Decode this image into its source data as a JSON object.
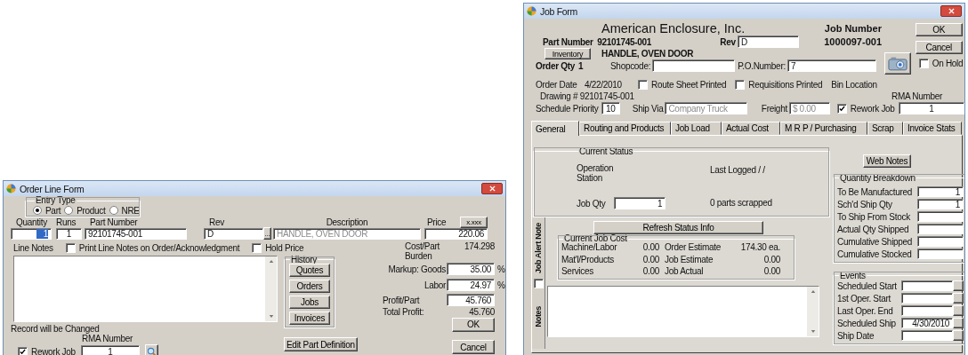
{
  "order_line_form": {
    "title": "Order Line Form",
    "entry_type": {
      "label": "Entry Type",
      "options": [
        {
          "label": "Part",
          "selected": true
        },
        {
          "label": "Product",
          "selected": false
        },
        {
          "label": "NRE",
          "selected": false
        }
      ]
    },
    "line_fields": [
      {
        "label": "Quantity",
        "value": "1",
        "selected": true
      },
      {
        "label": "Runs",
        "value": "1",
        "selected": false
      },
      {
        "label": "Part Number",
        "value": "92101745-001",
        "selected": false
      },
      {
        "label": "Rev",
        "value": "D",
        "selected": false
      },
      {
        "label": "Description",
        "value": "HANDLE, OVEN DOOR",
        "selected": false,
        "disabled": true
      },
      {
        "label": "Price",
        "value": "220.06",
        "selected": false
      }
    ],
    "lookup_button": "...",
    "price_format_button": "x.xxx",
    "line_notes_label": "Line Notes",
    "checkboxes": [
      {
        "label": "Print Line Notes on Order/Acknowledgment",
        "checked": false
      },
      {
        "label": "Hold Price",
        "checked": false
      }
    ],
    "history": {
      "label": "History",
      "buttons": [
        "Quotes",
        "Orders",
        "Jobs",
        "Invoices"
      ]
    },
    "edit_part_button": "Edit Part Definition",
    "cost_per_part": {
      "label": "Cost/Part",
      "value": "174.298"
    },
    "burden_label": "Burden",
    "markup_goods": {
      "label": "Markup: Goods",
      "value": "35.00",
      "unit": "%"
    },
    "labor": {
      "label": "Labor",
      "value": "24.97",
      "unit": "%"
    },
    "profit_per_part": {
      "label": "Profit/Part",
      "value": "45.760"
    },
    "total_profit": {
      "label": "Total Profit:",
      "value": "45.760"
    },
    "ok_button": "OK",
    "cancel_button": "Cancel",
    "status": "Record will be Changed",
    "rma": {
      "label": "RMA Number",
      "value": "1"
    },
    "rework_job": {
      "label": "Rework Job",
      "checked": true
    }
  },
  "job_form": {
    "title": "Job Form",
    "company": "American Enclosure, Inc.",
    "job_number": {
      "label": "Job Number",
      "value": "1000097-001"
    },
    "ok_button": "OK",
    "cancel_button": "Cancel",
    "on_hold": {
      "label": "On Hold",
      "checked": false
    },
    "part_number": {
      "label": "Part Number",
      "value": "92101745-001"
    },
    "rev": {
      "label": "Rev",
      "value": "D"
    },
    "inventory_button": "Inventory",
    "part_description": "HANDLE, OVEN DOOR",
    "order_qty": {
      "label": "Order Qty",
      "value": "1"
    },
    "shopcode": {
      "label": "Shopcode:"
    },
    "po_number": {
      "label": "P.O.Number:",
      "value": "7"
    },
    "order_date": {
      "label": "Order Date",
      "value": "4/22/2010"
    },
    "route_sheet_printed": {
      "label": "Route Sheet Printed",
      "checked": false
    },
    "requisitions_printed": {
      "label": "Requisitions Printed",
      "checked": false
    },
    "bin_location_label": "Bin Location",
    "drawing": "Drawing # 92101745-001",
    "rma": {
      "label": "RMA Number",
      "value": "1"
    },
    "schedule_priority": {
      "label": "Schedule Priority",
      "value": "10"
    },
    "ship_via": {
      "label": "Ship Via",
      "value": "Company Truck",
      "disabled": true
    },
    "freight": {
      "label": "Freight",
      "value": "$  0.00",
      "disabled": true
    },
    "rework_job": {
      "label": "Rework Job",
      "checked": true
    },
    "tabs": [
      {
        "label": "General",
        "selected": true
      },
      {
        "label": "Routing and Products",
        "selected": false
      },
      {
        "label": "Job Load",
        "selected": false
      },
      {
        "label": "Actual Cost",
        "selected": false
      },
      {
        "label": "M R P / Purchasing",
        "selected": false
      },
      {
        "label": "Scrap",
        "selected": false
      },
      {
        "label": "Invoice Stats",
        "selected": false
      }
    ],
    "current_status": {
      "label": "Current Status",
      "operation_label": "Operation",
      "station_label": "Station",
      "last_logged": "Last Logged  / /",
      "job_qty": {
        "label": "Job Qty",
        "value": "1"
      },
      "scrapped": "0 parts scrapped"
    },
    "refresh_button": "Refresh Status Info",
    "job_alert_note": {
      "label": "Job Alert Note",
      "checked": false
    },
    "notes_label": "Notes",
    "current_job_cost": {
      "label": "Current Job Cost",
      "rows": [
        {
          "label": "Machine/Labor",
          "value": "0.00",
          "estimate_label": "Order Estimate",
          "estimate_value": "174.30 ea."
        },
        {
          "label": "Mat'l/Products",
          "value": "0.00",
          "estimate_label": "Job Estimate",
          "estimate_value": "0.00"
        },
        {
          "label": "Services",
          "value": "0.00",
          "estimate_label": "Job Actual",
          "estimate_value": "0.00"
        }
      ]
    },
    "web_notes_button": "Web Notes",
    "quantity_breakdown": {
      "label": "Quantity Breakdown",
      "rows": [
        {
          "label": "To Be Manufactured",
          "value": "1"
        },
        {
          "label": "Sch'd Ship Qty",
          "value": "1"
        },
        {
          "label": "To Ship From Stock"
        },
        {
          "label": "Actual Qty Shipped"
        },
        {
          "label": "Cumulative Shipped"
        },
        {
          "label": "Cumulative Stocked"
        }
      ]
    },
    "events": {
      "label": "Events",
      "rows": [
        {
          "label": "Scheduled Start"
        },
        {
          "label": "1st Oper. Start"
        },
        {
          "label": "Last Oper. End"
        },
        {
          "label": "Scheduled Ship",
          "value": "4/30/2010"
        },
        {
          "label": "Ship Date"
        }
      ]
    }
  }
}
